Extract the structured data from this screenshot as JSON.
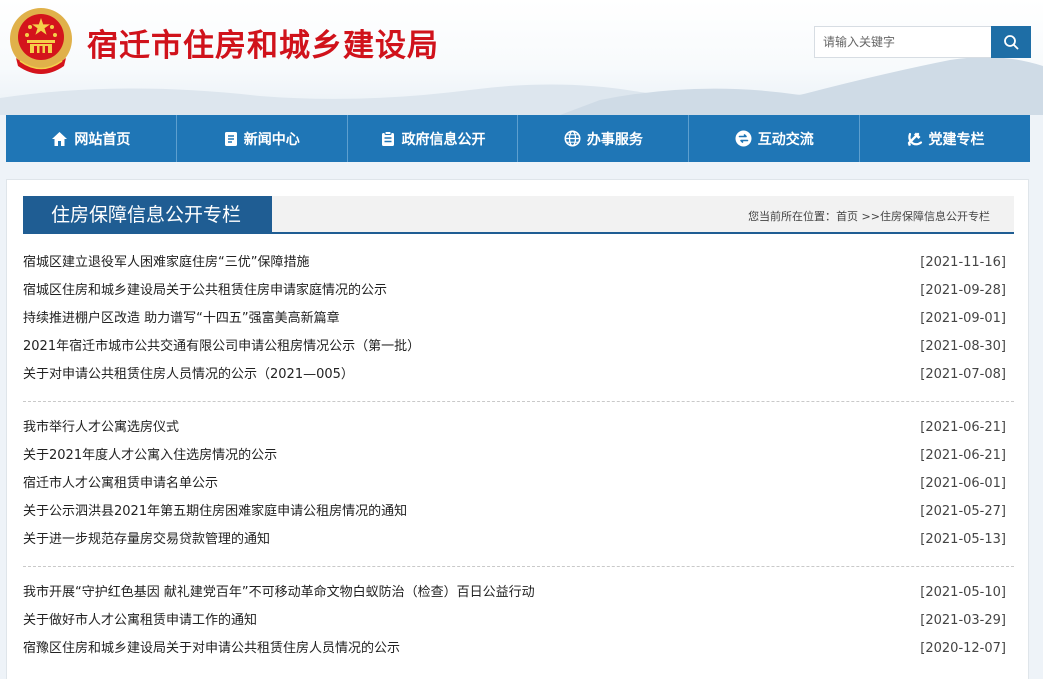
{
  "site": {
    "title": "宿迁市住房和城乡建设局"
  },
  "search": {
    "placeholder": "请输入关键字"
  },
  "nav": [
    {
      "label": "网站首页",
      "icon": "home-icon"
    },
    {
      "label": "新闻中心",
      "icon": "document-icon"
    },
    {
      "label": "政府信息公开",
      "icon": "clipboard-icon"
    },
    {
      "label": "办事服务",
      "icon": "globe-icon"
    },
    {
      "label": "互动交流",
      "icon": "exchange-icon"
    },
    {
      "label": "党建专栏",
      "icon": "party-emblem-icon"
    }
  ],
  "column": {
    "title": "住房保障信息公开专栏",
    "breadcrumb": {
      "prefix": "您当前所在位置：",
      "home": "首页",
      "sep": " >>",
      "current": "住房保障信息公开专栏"
    }
  },
  "groups": [
    [
      {
        "title": "宿城区建立退役军人困难家庭住房“三优”保障措施",
        "date": "[2021-11-16]"
      },
      {
        "title": "宿城区住房和城乡建设局关于公共租赁住房申请家庭情况的公示",
        "date": "[2021-09-28]"
      },
      {
        "title": "持续推进棚户区改造 助力谱写“十四五”强富美高新篇章",
        "date": "[2021-09-01]"
      },
      {
        "title": "2021年宿迁市城市公共交通有限公司申请公租房情况公示（第一批）",
        "date": "[2021-08-30]"
      },
      {
        "title": "关于对申请公共租赁住房人员情况的公示（2021—005）",
        "date": "[2021-07-08]"
      }
    ],
    [
      {
        "title": "我市举行人才公寓选房仪式",
        "date": "[2021-06-21]"
      },
      {
        "title": "关于2021年度人才公寓入住选房情况的公示",
        "date": "[2021-06-21]"
      },
      {
        "title": "宿迁市人才公寓租赁申请名单公示",
        "date": "[2021-06-01]"
      },
      {
        "title": "关于公示泗洪县2021年第五期住房困难家庭申请公租房情况的通知",
        "date": "[2021-05-27]"
      },
      {
        "title": "关于进一步规范存量房交易贷款管理的通知",
        "date": "[2021-05-13]"
      }
    ],
    [
      {
        "title": "我市开展“守护红色基因 献礼建党百年”不可移动革命文物白蚁防治（检查）百日公益行动",
        "date": "[2021-05-10]"
      },
      {
        "title": "关于做好市人才公寓租赁申请工作的通知",
        "date": "[2021-03-29]"
      },
      {
        "title": "宿豫区住房和城乡建设局关于对申请公共租赁住房人员情况的公示",
        "date": "[2020-12-07]"
      }
    ]
  ],
  "colors": {
    "brand_red": "#d0121b",
    "nav_blue": "#1f76b6",
    "column_blue": "#1f5d93"
  }
}
